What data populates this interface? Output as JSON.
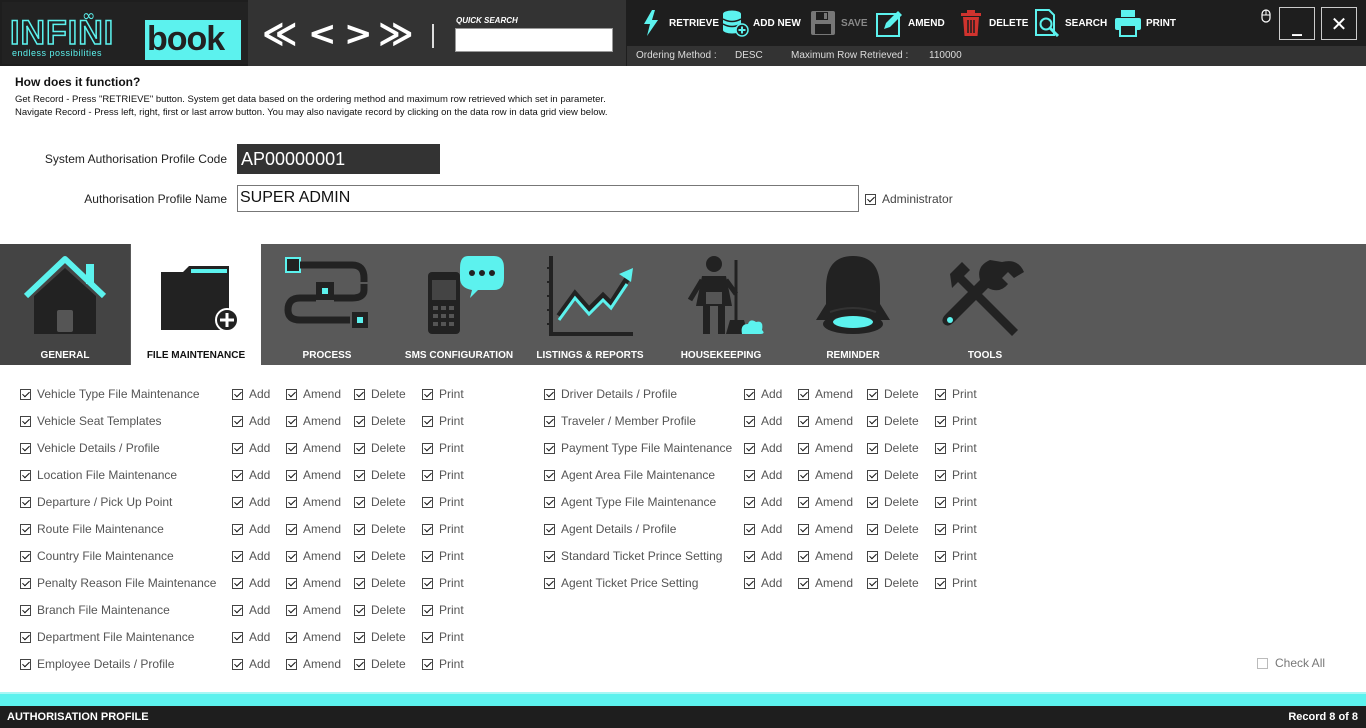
{
  "logo": {
    "brand_part1": "INFINI",
    "brand_part2": "book",
    "tagline": "endless possibilities"
  },
  "nav": {
    "first": "≪",
    "prev": "<",
    "next": ">",
    "last": "≫"
  },
  "quick_search": {
    "label": "QUICK SEARCH",
    "value": ""
  },
  "toolbar": {
    "retrieve": "RETRIEVE",
    "add_new": "ADD NEW",
    "save": "SAVE",
    "amend": "AMEND",
    "delete": "DELETE",
    "search": "SEARCH",
    "print": "PRINT"
  },
  "window": {
    "minimize": "_",
    "close": "✕"
  },
  "status": {
    "ordering_label": "Ordering Method :",
    "ordering_value": "DESC",
    "maxrow_label": "Maximum Row Retrieved :",
    "maxrow_value": "110000"
  },
  "info": {
    "title": "How does it function?",
    "line1": "Get Record - Press \"RETRIEVE\" button. System get data based on the ordering method and maximum row retrieved which set in parameter.",
    "line2": "Navigate Record - Press left, right, first or last arrow button. You may also navigate record by clicking on the data row in data grid view below."
  },
  "form": {
    "code_label": "System Authorisation Profile Code",
    "code_value": "AP00000001",
    "name_label": "Authorisation Profile Name",
    "name_value": "SUPER ADMIN",
    "admin_label": "Administrator",
    "admin_checked": true
  },
  "tabs": [
    {
      "label": "GENERAL",
      "icon": "home-icon"
    },
    {
      "label": "FILE MAINTENANCE",
      "icon": "folder-add-icon",
      "active": true
    },
    {
      "label": "PROCESS",
      "icon": "process-flow-icon"
    },
    {
      "label": "SMS CONFIGURATION",
      "icon": "phone-message-icon"
    },
    {
      "label": "LISTINGS & REPORTS",
      "icon": "chart-trend-icon"
    },
    {
      "label": "HOUSEKEEPING",
      "icon": "cleaner-icon"
    },
    {
      "label": "REMINDER",
      "icon": "bell-icon"
    },
    {
      "label": "TOOLS",
      "icon": "tools-icon"
    }
  ],
  "perm_labels": {
    "add": "Add",
    "amend": "Amend",
    "delete": "Delete",
    "print": "Print"
  },
  "permissions_left": [
    "Vehicle Type File Maintenance",
    "Vehicle Seat Templates",
    "Vehicle Details / Profile",
    "Location File Maintenance",
    "Departure / Pick Up Point",
    "Route File Maintenance",
    "Country File Maintenance",
    "Penalty Reason File Maintenance",
    "Branch File Maintenance",
    "Department File Maintenance",
    "Employee Details / Profile"
  ],
  "permissions_right": [
    "Driver Details / Profile",
    "Traveler / Member Profile",
    "Payment Type File Maintenance",
    "Agent Area File Maintenance",
    "Agent Type File Maintenance",
    "Agent Details / Profile",
    "Standard Ticket Prince Setting",
    "Agent Ticket Price Setting"
  ],
  "check_all": "Check All",
  "footer": {
    "title": "AUTHORISATION PROFILE",
    "record": "Record 8 of 8"
  },
  "colors": {
    "accent": "#5cf2ee",
    "dark": "#1e1e1e",
    "tabbar": "#595959"
  }
}
